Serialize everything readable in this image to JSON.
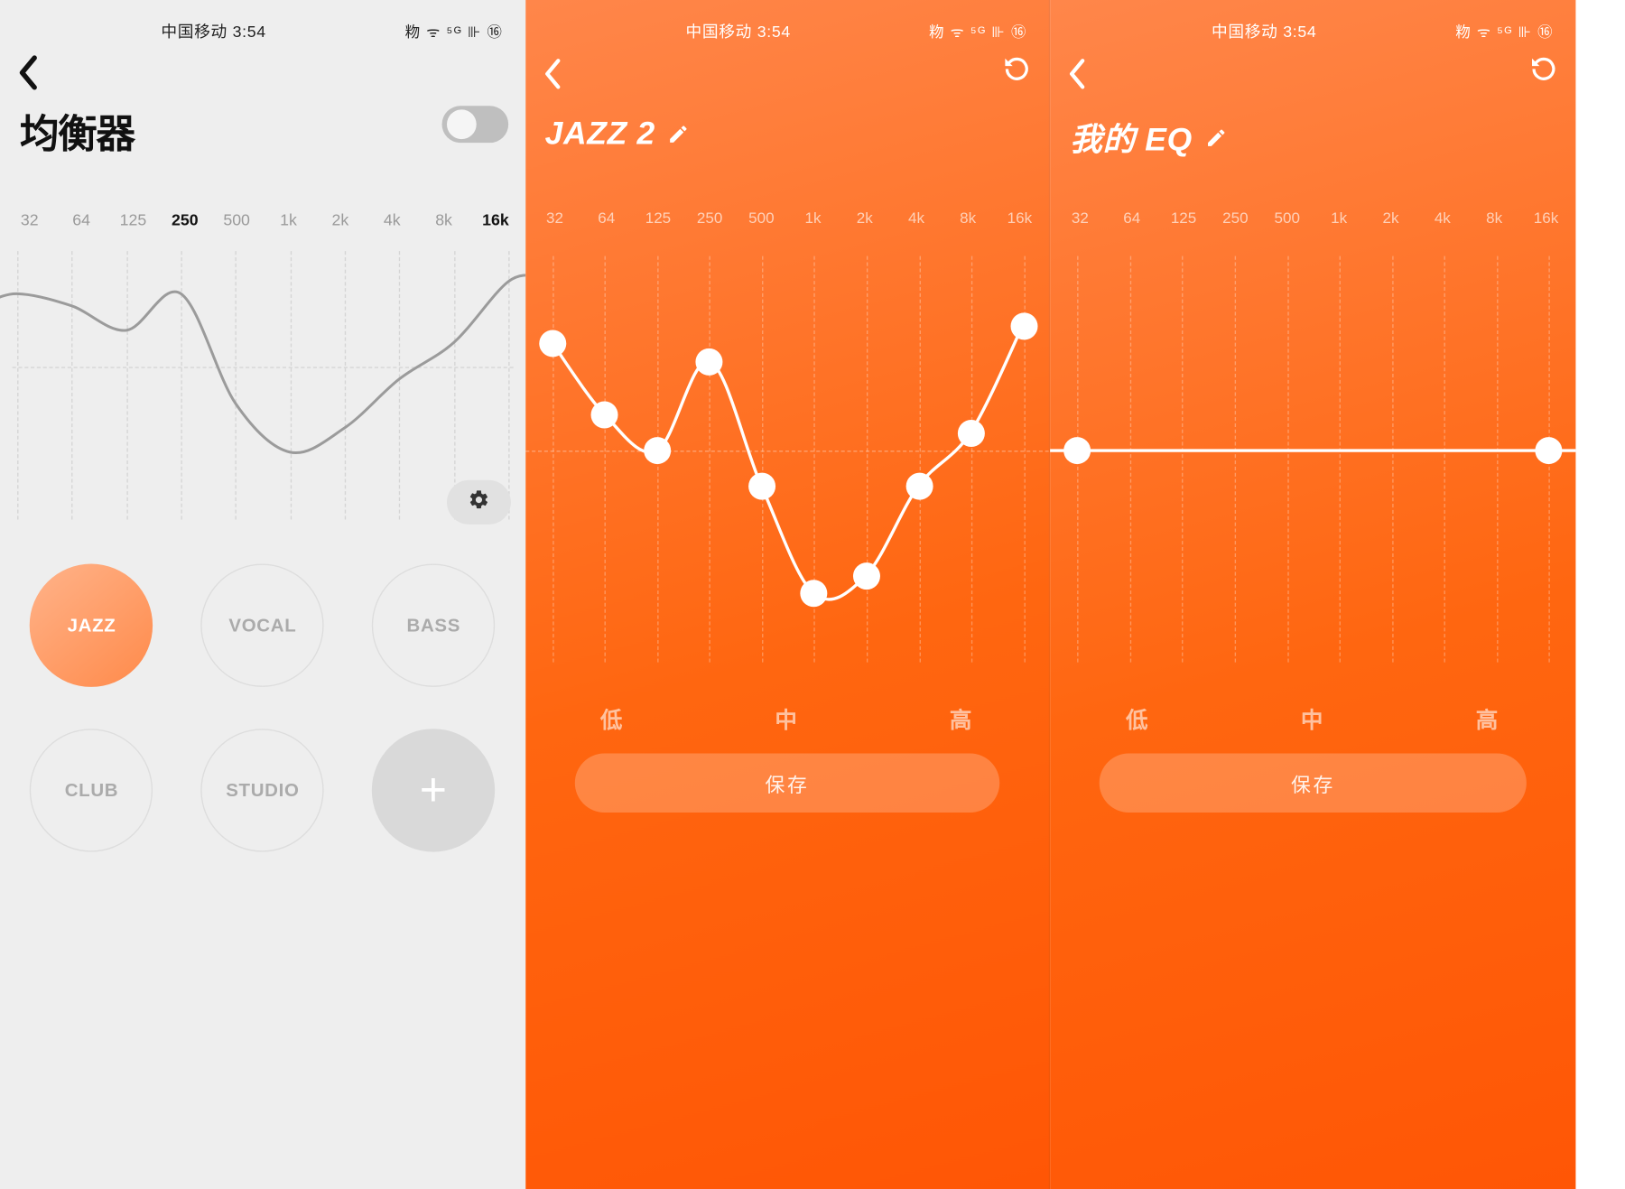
{
  "status": {
    "carrier_time": "中国移动 3:54",
    "right": "粅 ᯤ ⁵ᴳ ⊪ ⑯"
  },
  "screen1": {
    "title": "均衡器",
    "toggle_on": false,
    "freq_labels": [
      "32",
      "64",
      "125",
      "250",
      "500",
      "1k",
      "2k",
      "4k",
      "8k",
      "16k"
    ],
    "freq_bold_idx": [
      3,
      9
    ],
    "presets": [
      "JAZZ",
      "VOCAL",
      "BASS",
      "CLUB",
      "STUDIO"
    ],
    "selected_preset_idx": 0
  },
  "screen2": {
    "title": "JAZZ 2",
    "freq_labels": [
      "32",
      "64",
      "125",
      "250",
      "500",
      "1k",
      "2k",
      "4k",
      "8k",
      "16k"
    ],
    "bands": [
      "低",
      "中",
      "高"
    ],
    "save_label": "保存"
  },
  "screen3": {
    "title": "我的 EQ",
    "freq_labels": [
      "32",
      "64",
      "125",
      "250",
      "500",
      "1k",
      "2k",
      "4k",
      "8k",
      "16k"
    ],
    "bands": [
      "低",
      "中",
      "高"
    ],
    "save_label": "保存"
  },
  "chart_data": [
    {
      "type": "line",
      "title": "JAZZ preset curve (light screen)",
      "x_labels": [
        "32",
        "64",
        "125",
        "250",
        "500",
        "1k",
        "2k",
        "4k",
        "8k",
        "16k"
      ],
      "ylim": [
        -10,
        10
      ],
      "values": [
        6,
        5,
        3,
        6,
        -3,
        -7,
        -5,
        -1,
        2,
        7
      ]
    },
    {
      "type": "line",
      "title": "JAZZ 2 (editable)",
      "x_labels": [
        "32",
        "64",
        "125",
        "250",
        "500",
        "1k",
        "2k",
        "4k",
        "8k",
        "16k"
      ],
      "ylim": [
        -10,
        10
      ],
      "values": [
        6,
        2,
        0,
        5,
        -2,
        -8,
        -7,
        -2,
        1,
        7
      ]
    },
    {
      "type": "line",
      "title": "我的 EQ (flat)",
      "x_labels": [
        "32",
        "64",
        "125",
        "250",
        "500",
        "1k",
        "2k",
        "4k",
        "8k",
        "16k"
      ],
      "ylim": [
        -10,
        10
      ],
      "values": [
        0,
        0,
        0,
        0,
        0,
        0,
        0,
        0,
        0,
        0
      ]
    }
  ]
}
